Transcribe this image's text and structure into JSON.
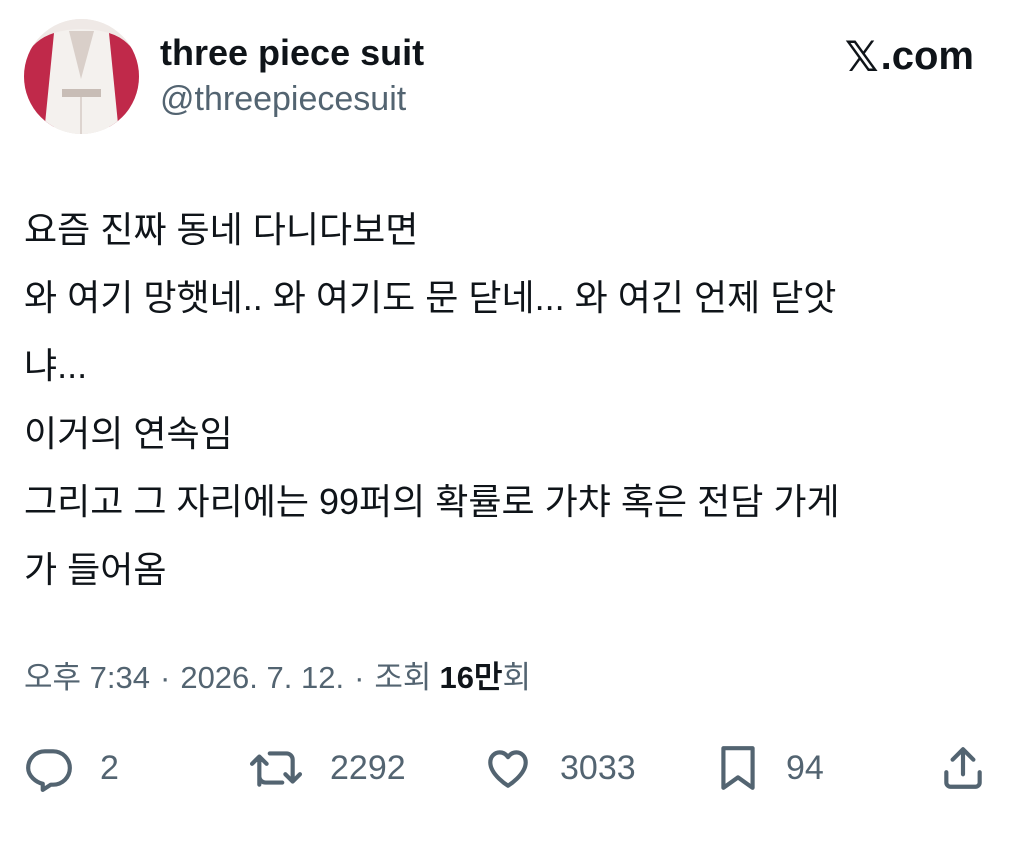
{
  "author": {
    "display_name": "three piece suit",
    "handle": "@threepiecesuit"
  },
  "brand": {
    "label": ".com",
    "icon": "x-logo-icon"
  },
  "tweet": {
    "lines": [
      "요즘 진짜 동네 다니다보면",
      "와 여기 망햇네.. 와 여기도 문 닫네... 와 여긴 언제 닫앗",
      "냐...",
      "이거의 연속임",
      "그리고 그 자리에는 99퍼의 확률로 가챠 혹은 전담 가게",
      "가 들어옴"
    ]
  },
  "meta": {
    "time": "오후 7:34",
    "separator": "·",
    "date": "2026. 7. 12.",
    "views_label": "조회",
    "views_number": "16만",
    "views_suffix": "회"
  },
  "actions": {
    "reply": {
      "icon": "reply-icon",
      "count": "2"
    },
    "retweet": {
      "icon": "retweet-icon",
      "count": "2292"
    },
    "like": {
      "icon": "heart-icon",
      "count": "3033"
    },
    "bookmark": {
      "icon": "bookmark-icon",
      "count": "94"
    },
    "share": {
      "icon": "share-icon"
    }
  },
  "colors": {
    "text_primary": "#0f1419",
    "text_secondary": "#536471",
    "avatar_background": "#c0294a"
  }
}
